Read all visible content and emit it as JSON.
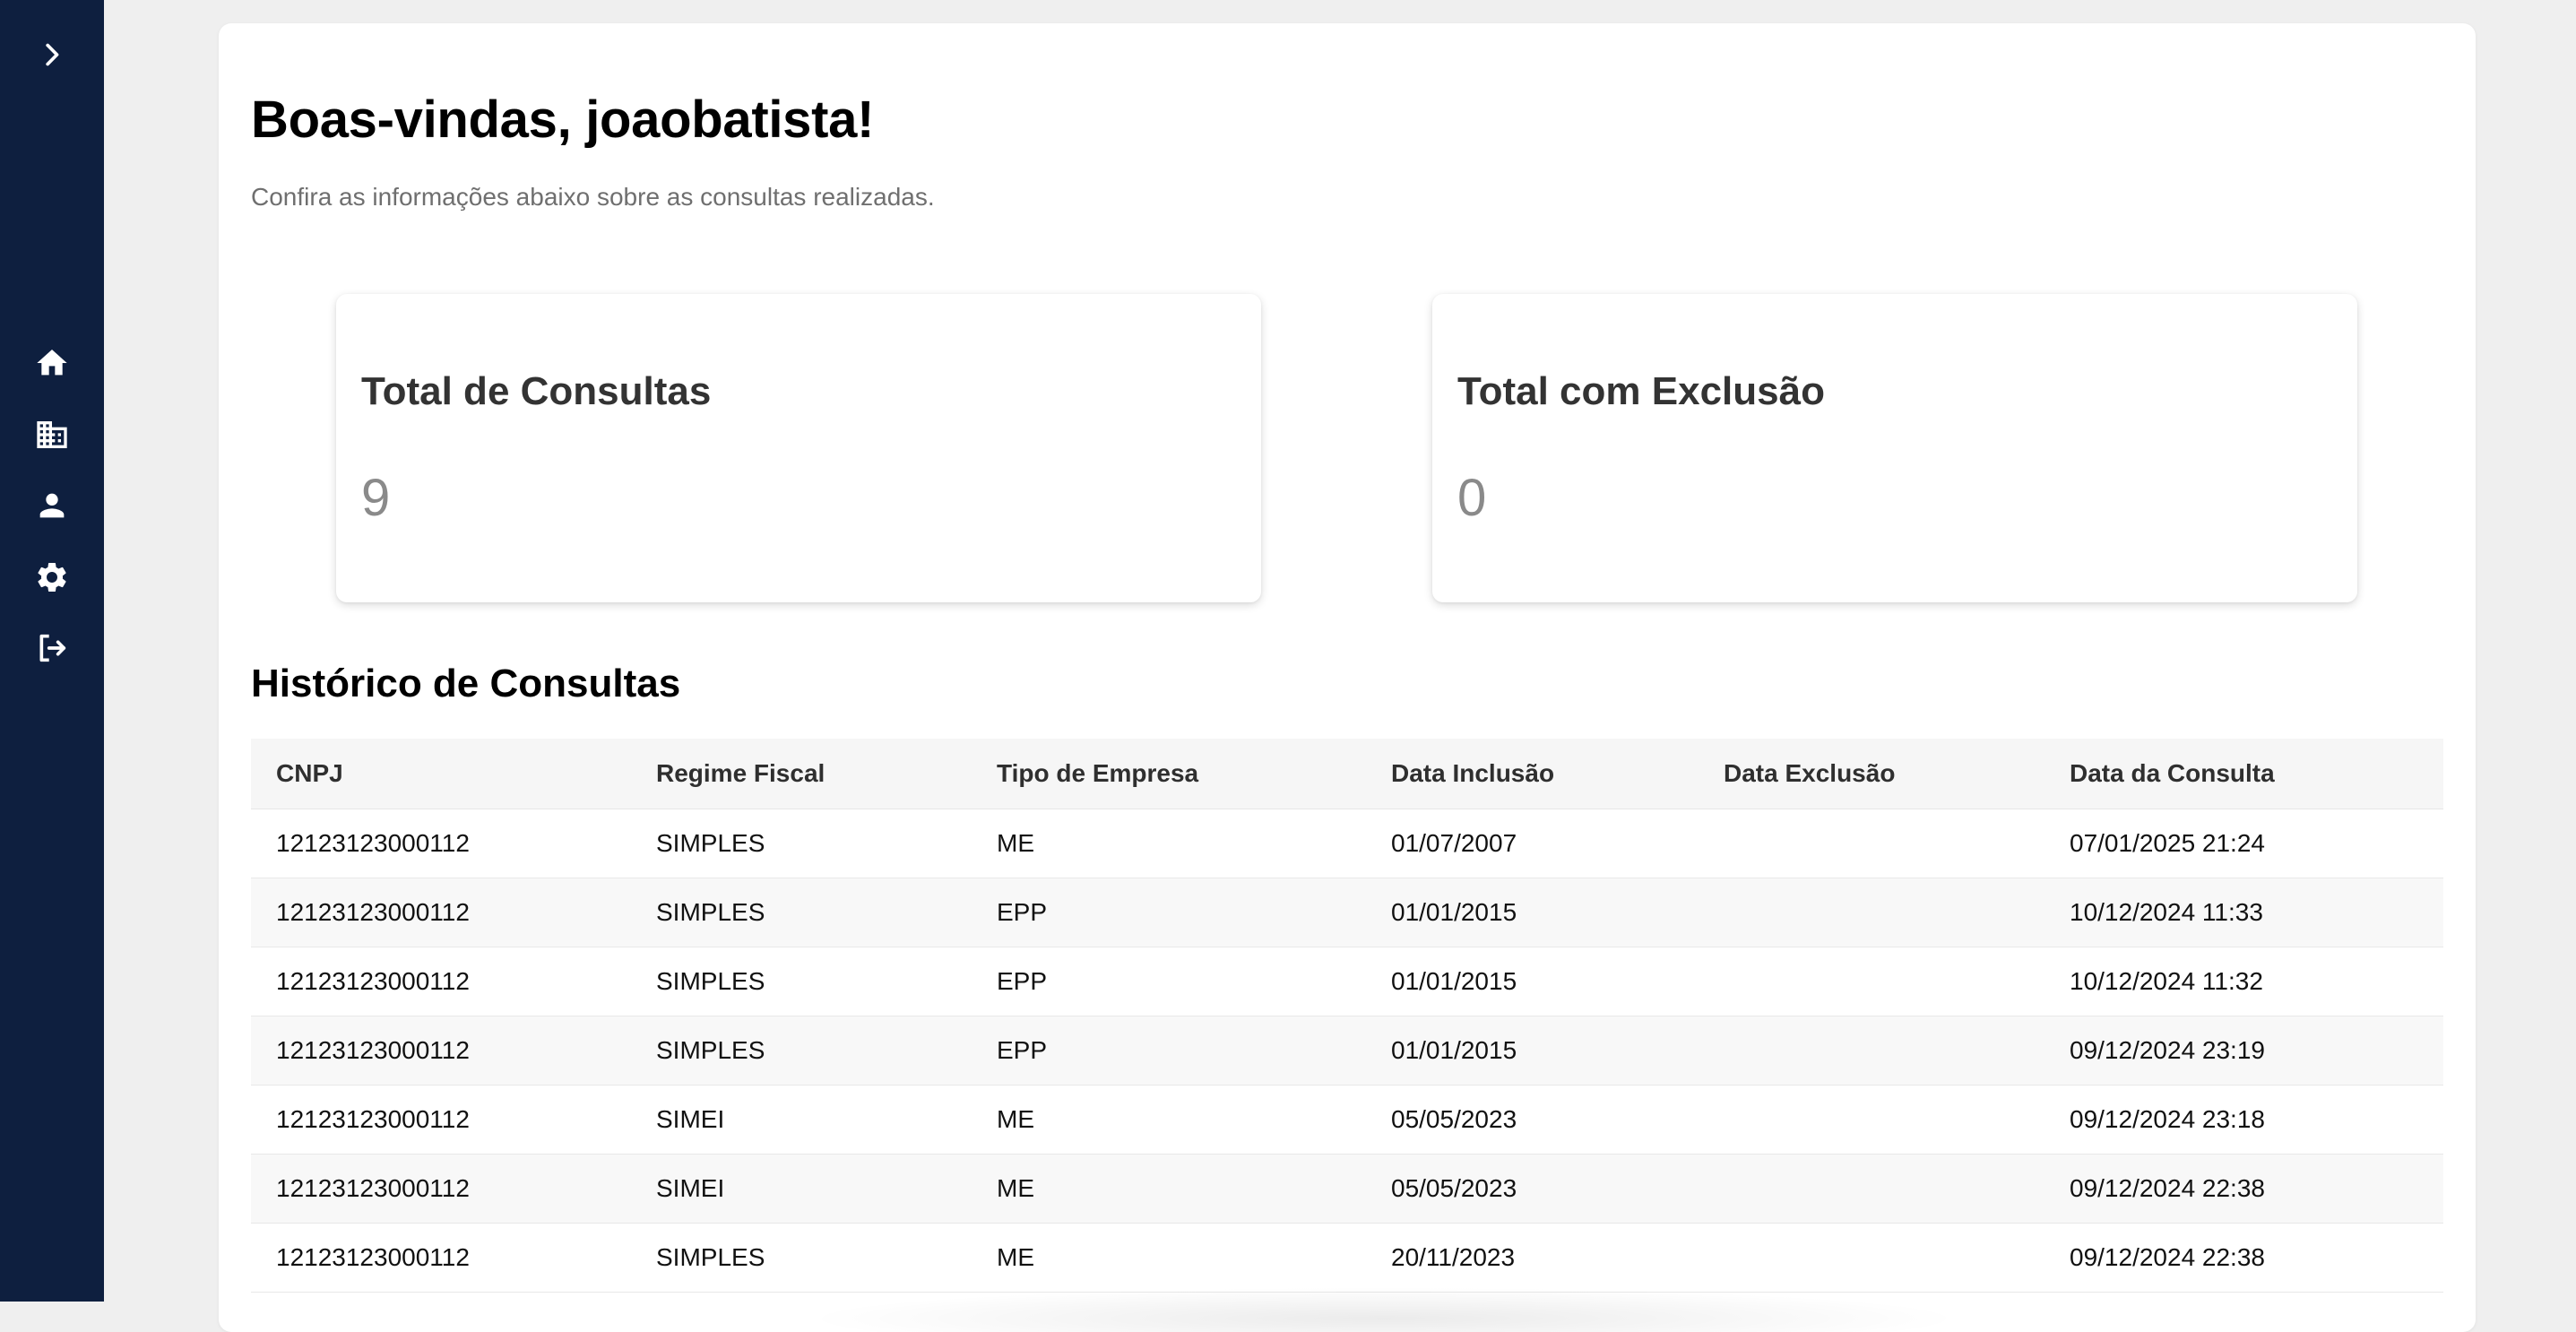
{
  "sidebar": {
    "expand_icon": "chevron-right-icon",
    "items": [
      {
        "name": "home",
        "icon": "home-icon"
      },
      {
        "name": "companies",
        "icon": "building-icon"
      },
      {
        "name": "profile",
        "icon": "person-icon"
      },
      {
        "name": "settings",
        "icon": "gear-icon"
      },
      {
        "name": "logout",
        "icon": "logout-icon"
      }
    ]
  },
  "header": {
    "title": "Boas-vindas, joaobatista!",
    "subtitle": "Confira as informações abaixo sobre as consultas realizadas."
  },
  "stats": [
    {
      "label": "Total de Consultas",
      "value": "9"
    },
    {
      "label": "Total com Exclusão",
      "value": "0"
    }
  ],
  "history": {
    "title": "Histórico de Consultas",
    "columns": [
      "CNPJ",
      "Regime Fiscal",
      "Tipo de Empresa",
      "Data Inclusão",
      "Data Exclusão",
      "Data da Consulta"
    ],
    "rows": [
      [
        "12123123000112",
        "SIMPLES",
        "ME",
        "01/07/2007",
        "",
        "07/01/2025 21:24"
      ],
      [
        "12123123000112",
        "SIMPLES",
        "EPP",
        "01/01/2015",
        "",
        "10/12/2024 11:33"
      ],
      [
        "12123123000112",
        "SIMPLES",
        "EPP",
        "01/01/2015",
        "",
        "10/12/2024 11:32"
      ],
      [
        "12123123000112",
        "SIMPLES",
        "EPP",
        "01/01/2015",
        "",
        "09/12/2024 23:19"
      ],
      [
        "12123123000112",
        "SIMEI",
        "ME",
        "05/05/2023",
        "",
        "09/12/2024 23:18"
      ],
      [
        "12123123000112",
        "SIMEI",
        "ME",
        "05/05/2023",
        "",
        "09/12/2024 22:38"
      ],
      [
        "12123123000112",
        "SIMPLES",
        "ME",
        "20/11/2023",
        "",
        "09/12/2024 22:38"
      ]
    ]
  },
  "colors": {
    "sidebar_bg": "#0e1f3f",
    "page_bg": "#efefef",
    "card_bg": "#ffffff"
  }
}
